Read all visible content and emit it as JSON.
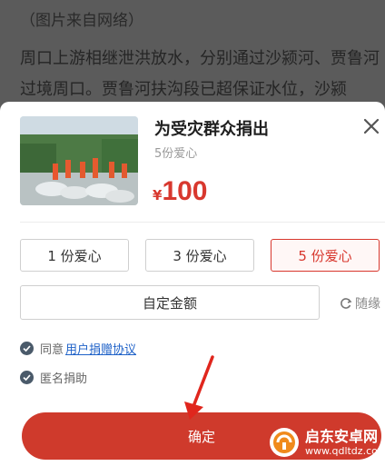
{
  "background": {
    "caption": "（图片来自网络）",
    "paragraph": "周口上游相继泄洪放水，分别通过沙颍河、贾鲁河过境周口。贾鲁河扶沟段已超保证水位，沙颍"
  },
  "sheet": {
    "title": "为受灾群众捐出",
    "subtitle": "5份爱心",
    "currency": "¥",
    "amount": "100",
    "options": [
      {
        "label": "1 份爱心",
        "selected": false
      },
      {
        "label": "3 份爱心",
        "selected": false
      },
      {
        "label": "5 份爱心",
        "selected": true
      }
    ],
    "custom_label": "自定金额",
    "random_label": "随缘",
    "agree_prefix": "同意",
    "agree_link": "用户捐赠协议",
    "anonymous_label": "匿名捐助",
    "confirm_label": "确定"
  },
  "watermark": {
    "name": "启东安卓网",
    "url": "www.qdltdz.com"
  },
  "colors": {
    "accent": "#d8382e",
    "link": "#1f62c8"
  }
}
